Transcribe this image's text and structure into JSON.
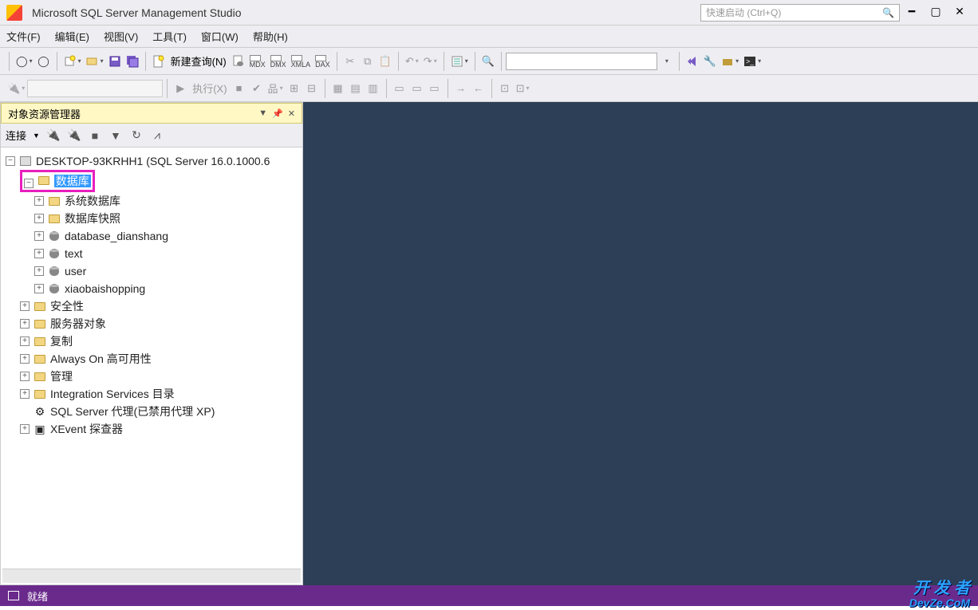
{
  "title": "Microsoft SQL Server Management Studio",
  "quicklaunch_placeholder": "快速启动 (Ctrl+Q)",
  "menu": [
    "文件(F)",
    "编辑(E)",
    "视图(V)",
    "工具(T)",
    "窗口(W)",
    "帮助(H)"
  ],
  "toolbar": {
    "new_query": "新建查询(N)",
    "execute": "执行(X)"
  },
  "panel": {
    "title": "对象资源管理器",
    "connect_label": "连接"
  },
  "tree": {
    "server": "DESKTOP-93KRHH1 (SQL Server 16.0.1000.6",
    "databases": "数据库",
    "children_db": [
      "系统数据库",
      "数据库快照"
    ],
    "user_dbs": [
      "database_dianshang",
      "text",
      "user",
      "xiaobaishopping"
    ],
    "siblings": [
      "安全性",
      "服务器对象",
      "复制",
      "Always On 高可用性",
      "管理",
      "Integration Services 目录"
    ],
    "agent": "SQL Server 代理(已禁用代理 XP)",
    "xevent": "XEvent 探查器"
  },
  "status": "就绪",
  "watermark": {
    "top": "开 发 者",
    "bottom": "DevZe.CoM"
  }
}
